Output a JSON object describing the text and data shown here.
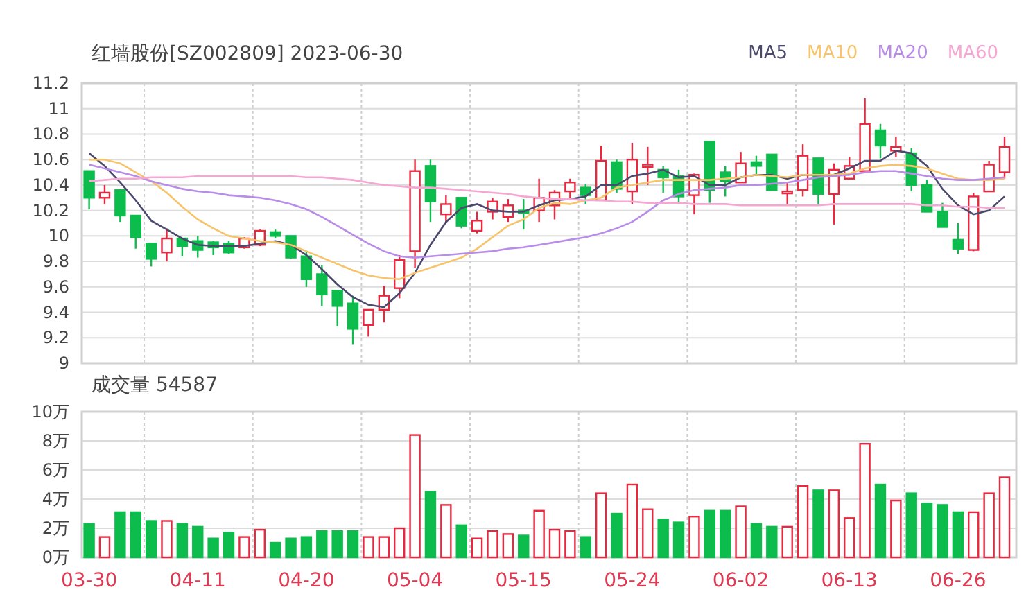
{
  "price_panel": {
    "title": "红墙股份[SZ002809] 2023-06-30",
    "chart_data": {
      "type": "candlestick",
      "grid": true,
      "categories": [
        null,
        null,
        null,
        null,
        null,
        null,
        null,
        null,
        null,
        null,
        null,
        null,
        null,
        null,
        null,
        null,
        null,
        null,
        null,
        null,
        null,
        null,
        null,
        null,
        null,
        null,
        null,
        null,
        null,
        null,
        null,
        null,
        null,
        null,
        null,
        null,
        null,
        null,
        null,
        null,
        null,
        null,
        null,
        null,
        null,
        null,
        null,
        null,
        null,
        null,
        null,
        null,
        null,
        null,
        null,
        null,
        null,
        null,
        null,
        null
      ],
      "ylim": [
        9,
        11.2
      ],
      "yticks": [
        9,
        9.2,
        9.4,
        9.6,
        9.8,
        10,
        10.2,
        10.4,
        10.6,
        10.8,
        11,
        11.2
      ],
      "ohlc": [
        [
          10.51,
          10.51,
          10.21,
          10.3
        ],
        [
          10.3,
          10.4,
          10.25,
          10.34
        ],
        [
          10.36,
          10.37,
          10.11,
          10.16
        ],
        [
          10.16,
          10.16,
          9.9,
          9.99
        ],
        [
          9.94,
          9.94,
          9.76,
          9.82
        ],
        [
          9.87,
          10.06,
          9.8,
          9.98
        ],
        [
          9.98,
          9.98,
          9.84,
          9.92
        ],
        [
          9.96,
          10.0,
          9.83,
          9.89
        ],
        [
          9.95,
          9.96,
          9.85,
          9.91
        ],
        [
          9.94,
          9.96,
          9.86,
          9.87
        ],
        [
          9.91,
          9.99,
          9.9,
          9.98
        ],
        [
          9.93,
          10.05,
          9.92,
          10.04
        ],
        [
          10.03,
          10.05,
          9.98,
          10.0
        ],
        [
          10.0,
          10.0,
          9.82,
          9.83
        ],
        [
          9.84,
          9.88,
          9.6,
          9.66
        ],
        [
          9.7,
          9.77,
          9.45,
          9.54
        ],
        [
          9.57,
          9.57,
          9.29,
          9.45
        ],
        [
          9.47,
          9.53,
          9.15,
          9.27
        ],
        [
          9.3,
          9.42,
          9.21,
          9.42
        ],
        [
          9.42,
          9.61,
          9.32,
          9.53
        ],
        [
          9.59,
          9.85,
          9.51,
          9.81
        ],
        [
          9.88,
          10.6,
          9.75,
          10.51
        ],
        [
          10.55,
          10.6,
          10.11,
          10.27
        ],
        [
          10.17,
          10.32,
          10.1,
          10.25
        ],
        [
          10.3,
          10.3,
          10.06,
          10.08
        ],
        [
          10.04,
          10.19,
          10.02,
          10.12
        ],
        [
          10.19,
          10.3,
          10.13,
          10.27
        ],
        [
          10.15,
          10.29,
          10.11,
          10.24
        ],
        [
          10.2,
          10.29,
          10.05,
          10.18
        ],
        [
          10.2,
          10.45,
          10.11,
          10.3
        ],
        [
          10.24,
          10.36,
          10.13,
          10.34
        ],
        [
          10.35,
          10.45,
          10.28,
          10.42
        ],
        [
          10.38,
          10.41,
          10.25,
          10.32
        ],
        [
          10.28,
          10.71,
          10.28,
          10.59
        ],
        [
          10.58,
          10.6,
          10.34,
          10.37
        ],
        [
          10.35,
          10.73,
          10.25,
          10.6
        ],
        [
          10.54,
          10.7,
          10.4,
          10.56
        ],
        [
          10.52,
          10.55,
          10.34,
          10.46
        ],
        [
          10.47,
          10.52,
          10.26,
          10.31
        ],
        [
          10.32,
          10.49,
          10.17,
          10.48
        ],
        [
          10.74,
          10.74,
          10.26,
          10.36
        ],
        [
          10.5,
          10.55,
          10.31,
          10.43
        ],
        [
          10.42,
          10.66,
          10.42,
          10.57
        ],
        [
          10.58,
          10.63,
          10.48,
          10.55
        ],
        [
          10.64,
          10.64,
          10.36,
          10.36
        ],
        [
          10.34,
          10.42,
          10.25,
          10.35
        ],
        [
          10.36,
          10.72,
          10.31,
          10.63
        ],
        [
          10.61,
          10.61,
          10.25,
          10.33
        ],
        [
          10.33,
          10.57,
          10.09,
          10.52
        ],
        [
          10.45,
          10.62,
          10.45,
          10.55
        ],
        [
          10.51,
          11.08,
          10.51,
          10.88
        ],
        [
          10.83,
          10.88,
          10.61,
          10.71
        ],
        [
          10.67,
          10.78,
          10.62,
          10.7
        ],
        [
          10.65,
          10.69,
          10.35,
          10.4
        ],
        [
          10.4,
          10.44,
          10.19,
          10.19
        ],
        [
          10.19,
          10.26,
          10.07,
          10.07
        ],
        [
          9.97,
          10.1,
          9.86,
          9.9
        ],
        [
          9.89,
          10.34,
          9.88,
          10.31
        ],
        [
          10.35,
          10.59,
          10.35,
          10.56
        ],
        [
          10.5,
          10.78,
          10.45,
          10.7
        ]
      ],
      "series": [
        {
          "name": "MA5",
          "color": "#4b4a6e",
          "type": "line",
          "values": [
            10.65,
            10.55,
            10.42,
            10.28,
            10.12,
            10.05,
            9.98,
            9.93,
            9.92,
            9.92,
            9.92,
            9.94,
            9.96,
            9.93,
            9.85,
            9.74,
            9.62,
            9.52,
            9.46,
            9.44,
            9.55,
            9.71,
            9.93,
            10.11,
            10.22,
            10.25,
            10.2,
            10.19,
            10.19,
            10.24,
            10.28,
            10.29,
            10.31,
            10.4,
            10.4,
            10.47,
            10.49,
            10.52,
            10.46,
            10.47,
            10.4,
            10.4,
            10.46,
            10.48,
            10.48,
            10.45,
            10.48,
            10.48,
            10.48,
            10.53,
            10.59,
            10.59,
            10.67,
            10.65,
            10.55,
            10.37,
            10.24,
            10.17,
            10.2,
            10.31
          ]
        },
        {
          "name": "MA10",
          "color": "#f7c46c",
          "type": "line",
          "values": [
            10.6,
            10.6,
            10.57,
            10.5,
            10.43,
            10.34,
            10.23,
            10.13,
            10.06,
            10.0,
            9.98,
            9.96,
            9.95,
            9.93,
            9.88,
            9.83,
            9.78,
            9.73,
            9.69,
            9.67,
            9.66,
            9.71,
            9.75,
            9.79,
            9.83,
            9.9,
            9.99,
            10.08,
            10.13,
            10.22,
            10.26,
            10.25,
            10.28,
            10.3,
            10.38,
            10.4,
            10.42,
            10.44,
            10.44,
            10.44,
            10.44,
            10.45,
            10.46,
            10.48,
            10.47,
            10.46,
            10.48,
            10.48,
            10.48,
            10.49,
            10.53,
            10.55,
            10.56,
            10.55,
            10.53,
            10.49,
            10.45,
            10.44,
            10.44,
            10.45
          ]
        },
        {
          "name": "MA20",
          "color": "#b98ce8",
          "type": "line",
          "values": [
            10.56,
            10.53,
            10.5,
            10.47,
            10.43,
            10.4,
            10.37,
            10.35,
            10.34,
            10.32,
            10.31,
            10.3,
            10.28,
            10.25,
            10.21,
            10.15,
            10.08,
            10.01,
            9.94,
            9.88,
            9.84,
            9.83,
            9.84,
            9.85,
            9.86,
            9.87,
            9.88,
            9.9,
            9.91,
            9.93,
            9.95,
            9.97,
            9.99,
            10.02,
            10.06,
            10.11,
            10.19,
            10.28,
            10.33,
            10.36,
            10.37,
            10.38,
            10.4,
            10.4,
            10.41,
            10.42,
            10.44,
            10.46,
            10.47,
            10.48,
            10.5,
            10.51,
            10.51,
            10.49,
            10.47,
            10.45,
            10.44,
            10.44,
            10.45,
            10.46
          ]
        },
        {
          "name": "MA60",
          "color": "#f6a6d2",
          "type": "line",
          "values": [
            10.43,
            10.44,
            10.45,
            10.45,
            10.46,
            10.46,
            10.46,
            10.47,
            10.47,
            10.47,
            10.47,
            10.47,
            10.47,
            10.47,
            10.46,
            10.46,
            10.45,
            10.44,
            10.42,
            10.4,
            10.39,
            10.38,
            10.38,
            10.37,
            10.36,
            10.35,
            10.34,
            10.33,
            10.31,
            10.3,
            10.29,
            10.29,
            10.28,
            10.28,
            10.27,
            10.27,
            10.26,
            10.26,
            10.26,
            10.25,
            10.25,
            10.25,
            10.24,
            10.24,
            10.24,
            10.24,
            10.24,
            10.24,
            10.25,
            10.25,
            10.25,
            10.25,
            10.25,
            10.25,
            10.24,
            10.24,
            10.23,
            10.23,
            10.22,
            10.22
          ]
        }
      ]
    }
  },
  "volume_panel": {
    "title": "成交量 54587",
    "chart_data": {
      "type": "bar",
      "grid": true,
      "categories": [
        "03-30",
        null,
        null,
        null,
        null,
        null,
        null,
        "04-11",
        null,
        null,
        null,
        null,
        null,
        null,
        "04-20",
        null,
        null,
        null,
        null,
        null,
        null,
        "05-04",
        null,
        null,
        null,
        null,
        null,
        null,
        "05-15",
        null,
        null,
        null,
        null,
        null,
        null,
        "05-24",
        null,
        null,
        null,
        null,
        null,
        null,
        "06-02",
        null,
        null,
        null,
        null,
        null,
        null,
        "06-13",
        null,
        null,
        null,
        null,
        null,
        null,
        "06-26",
        null,
        null,
        null
      ],
      "ylim": [
        0,
        10
      ],
      "yticks": [
        {
          "value": 0,
          "label": "0万"
        },
        {
          "value": 2,
          "label": "2万"
        },
        {
          "value": 4,
          "label": "4万"
        },
        {
          "value": 6,
          "label": "6万"
        },
        {
          "value": 8,
          "label": "8万"
        },
        {
          "value": 10,
          "label": "10万"
        }
      ],
      "series": [
        {
          "values": [
            2.3,
            1.4,
            3.1,
            3.1,
            2.5,
            2.5,
            2.3,
            2.1,
            1.3,
            1.7,
            1.4,
            1.9,
            1.0,
            1.3,
            1.4,
            1.8,
            1.8,
            1.8,
            1.4,
            1.4,
            2.0,
            8.4,
            4.5,
            3.6,
            2.2,
            1.3,
            1.8,
            1.6,
            1.5,
            3.2,
            1.9,
            1.8,
            1.4,
            4.4,
            3.0,
            5.0,
            3.3,
            2.6,
            2.4,
            2.8,
            3.2,
            3.2,
            3.5,
            2.3,
            2.1,
            2.1,
            4.9,
            4.6,
            4.6,
            2.7,
            7.8,
            5.0,
            3.9,
            4.4,
            3.7,
            3.6,
            3.1,
            3.1,
            4.4,
            5.5
          ]
        }
      ]
    }
  }
}
